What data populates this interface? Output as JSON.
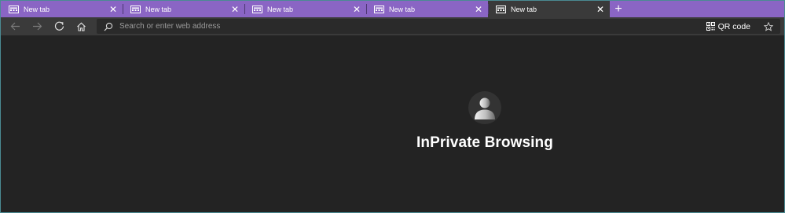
{
  "tabs": [
    {
      "title": "New tab",
      "active": false
    },
    {
      "title": "New tab",
      "active": false
    },
    {
      "title": "New tab",
      "active": false
    },
    {
      "title": "New tab",
      "active": false
    },
    {
      "title": "New tab",
      "active": true
    }
  ],
  "tab_close_glyph": "✕",
  "new_tab_glyph": "+",
  "toolbar": {
    "back_icon": "arrow-left-icon",
    "forward_icon": "arrow-right-icon",
    "refresh_icon": "refresh-icon",
    "home_icon": "home-icon"
  },
  "address_bar": {
    "placeholder": "Search or enter web address",
    "value": ""
  },
  "qr_button": {
    "label": "QR code"
  },
  "page": {
    "heading": "InPrivate Browsing"
  },
  "colors": {
    "tabstrip": "#8a65c4",
    "active_tab": "#3a3a3a",
    "toolbar": "#3a3a3a",
    "page_background": "#232323"
  }
}
